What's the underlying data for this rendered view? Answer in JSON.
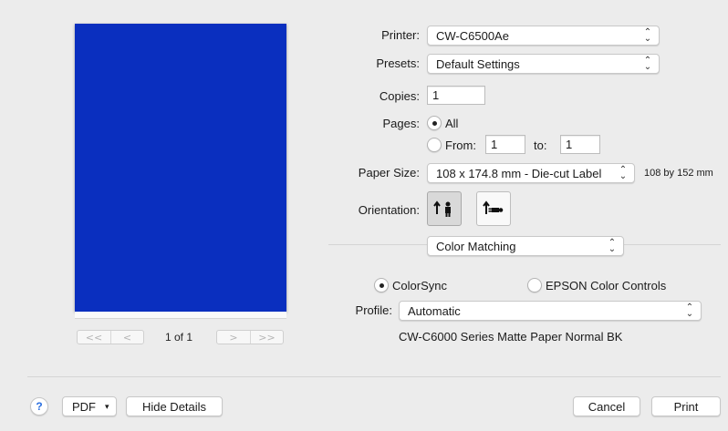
{
  "preview": {
    "page_color": "#0a2fbf",
    "page_count": "1 of 1",
    "nav": {
      "first": "<<",
      "prev": "<",
      "next": ">",
      "last": ">>"
    }
  },
  "printer": {
    "label": "Printer:",
    "value": "CW-C6500Ae"
  },
  "presets": {
    "label": "Presets:",
    "value": "Default Settings"
  },
  "copies": {
    "label": "Copies:",
    "value": "1"
  },
  "pages": {
    "label": "Pages:",
    "all_label": "All",
    "from_label": "From:",
    "from_value": "1",
    "to_label": "to:",
    "to_value": "1",
    "selected": "all"
  },
  "paper_size": {
    "label": "Paper Size:",
    "value": "108 x 174.8 mm - Die-cut Label",
    "dimension_note": "108 by 152 mm"
  },
  "orientation": {
    "label": "Orientation:",
    "selected": "portrait",
    "options": [
      "portrait-icon",
      "landscape-icon"
    ]
  },
  "section": {
    "value": "Color Matching"
  },
  "color_matching": {
    "colorsync_label": "ColorSync",
    "epson_label": "EPSON Color Controls",
    "selected": "colorsync",
    "profile_label": "Profile:",
    "profile_value": "Automatic",
    "profile_description": "CW-C6000 Series Matte Paper Normal BK"
  },
  "footer": {
    "help_label": "?",
    "pdf_label": "PDF",
    "hide_details_label": "Hide Details",
    "cancel_label": "Cancel",
    "print_label": "Print"
  }
}
